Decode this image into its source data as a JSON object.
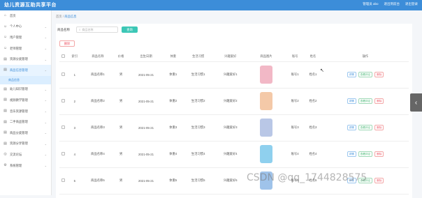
{
  "header": {
    "title": "幼儿资源互助共享平台",
    "links": [
      "管理员 abo",
      "退出到前台",
      "退出登录"
    ]
  },
  "sidebar": {
    "items": [
      {
        "label": "首页",
        "icon": "home-icon",
        "glyph": "⌂",
        "active": false,
        "chev": false
      },
      {
        "label": "个人中心",
        "icon": "user-icon",
        "glyph": "☺",
        "active": false,
        "chev": true
      },
      {
        "label": "用户管理",
        "icon": "user-icon",
        "glyph": "☺",
        "active": false,
        "chev": true
      },
      {
        "label": "老师管理",
        "icon": "user-icon",
        "glyph": "☺",
        "active": false,
        "chev": true
      },
      {
        "label": "资源分类管理",
        "icon": "doc-icon",
        "glyph": "▤",
        "active": false,
        "chev": true
      },
      {
        "label": "商品信息管理",
        "icon": "doc-icon",
        "glyph": "▤",
        "active": true,
        "chev": true
      }
    ],
    "sub_item": "商品信息",
    "items_after": [
      {
        "label": "幼儿知识管理",
        "icon": "doc-icon",
        "glyph": "▤",
        "chev": true
      },
      {
        "label": "视频教学管理",
        "icon": "doc-icon",
        "glyph": "▤",
        "chev": true
      },
      {
        "label": "音乐资源管理",
        "icon": "doc-icon",
        "glyph": "▤",
        "chev": true
      },
      {
        "label": "二手商品管理",
        "icon": "doc-icon",
        "glyph": "▤",
        "chev": true
      },
      {
        "label": "商品分类管理",
        "icon": "doc-icon",
        "glyph": "▤",
        "chev": true
      },
      {
        "label": "资源分享管理",
        "icon": "doc-icon",
        "glyph": "▤",
        "chev": true
      },
      {
        "label": "交流论坛",
        "icon": "chat-icon",
        "glyph": "◎",
        "chev": true
      },
      {
        "label": "系统管理",
        "icon": "gear-icon",
        "glyph": "⚙",
        "chev": true
      }
    ]
  },
  "breadcrumb": {
    "home": "首页",
    "sep": "/",
    "current": "商品信息"
  },
  "search": {
    "label": "商品名称",
    "placeholder": "商品名称",
    "button": "查询"
  },
  "delete_button": "删除",
  "table": {
    "headers": [
      "",
      "索引",
      "商品名称",
      "价格",
      "出生日期",
      "体重",
      "生活习惯",
      "兴趣爱好",
      "商品图片",
      "账号",
      "姓名",
      "操作"
    ],
    "rows": [
      {
        "index": "1",
        "name": "商品名称1",
        "price": "男",
        "date": "2021-05-21",
        "weight": "体重1",
        "habit": "生活习惯1",
        "hobby": "兴趣爱好1",
        "account": "账号1",
        "person": "姓名1",
        "img_color": "#f2b8c6"
      },
      {
        "index": "2",
        "name": "商品名称2",
        "price": "男",
        "date": "2021-05-21",
        "weight": "体重2",
        "habit": "生活习惯2",
        "hobby": "兴趣爱好2",
        "account": "账号2",
        "person": "姓名2",
        "img_color": "#f4c9a8"
      },
      {
        "index": "3",
        "name": "商品名称3",
        "price": "男",
        "date": "2021-05-21",
        "weight": "体重3",
        "habit": "生活习惯3",
        "hobby": "兴趣爱好3",
        "account": "账号3",
        "person": "姓名3",
        "img_color": "#b9c7e6"
      },
      {
        "index": "4",
        "name": "商品名称4",
        "price": "男",
        "date": "2021-05-21",
        "weight": "体重4",
        "habit": "生活习惯4",
        "hobby": "兴趣爱好4",
        "account": "账号4",
        "person": "姓名4",
        "img_color": "#8fd0ee"
      },
      {
        "index": "5",
        "name": "商品名称5",
        "price": "男",
        "date": "2021-05-21",
        "weight": "体重5",
        "habit": "生活习惯5",
        "hobby": "兴趣爱好5",
        "account": "账号5",
        "person": "姓名5",
        "img_color": "#9fc3ea"
      }
    ],
    "ops": {
      "view": "详情",
      "comment": "查看评论",
      "delete": "删除"
    }
  },
  "collapse_glyph": "‹",
  "watermark": "CSDN @qq_1744828575",
  "colors": {
    "primary": "#3c8dd9",
    "search_btn": "#3cc7b6",
    "danger": "#ee5566"
  }
}
